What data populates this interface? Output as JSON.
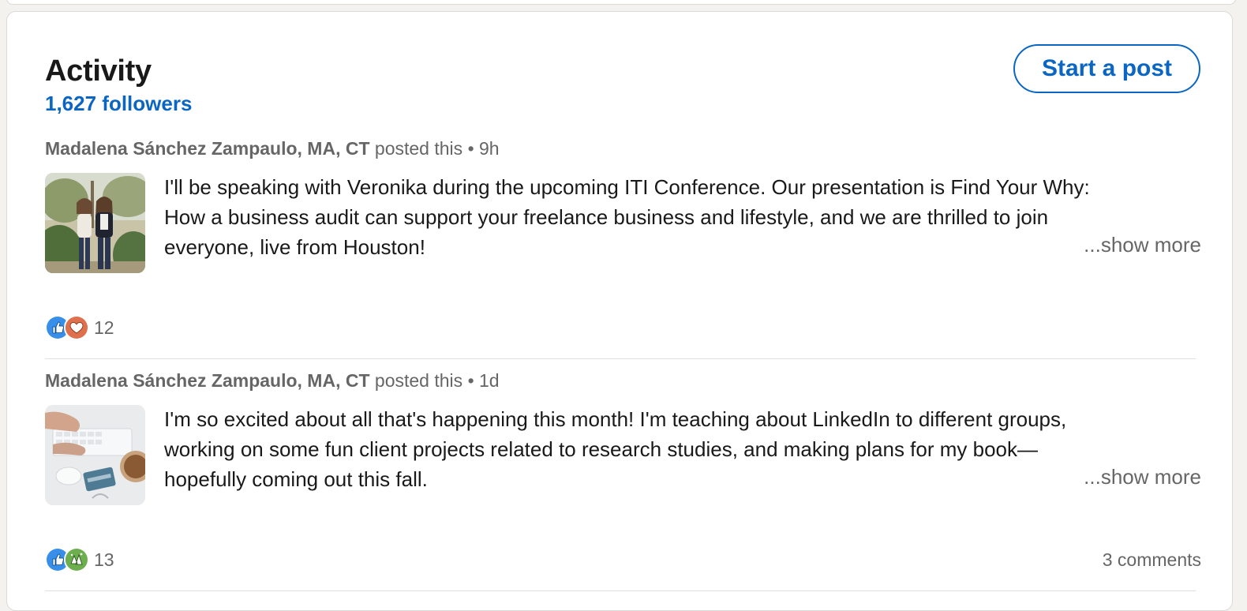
{
  "activity": {
    "title": "Activity",
    "followers": "1,627 followers",
    "start_post_label": "Start a post"
  },
  "posts": [
    {
      "author": "Madalena Sánchez Zampaulo, MA, CT",
      "action": "posted this",
      "separator": "•",
      "time": "9h",
      "text_lines": [
        "I'll be speaking with Veronika during the upcoming ITI Conference. Our presentation is Find Your Why:",
        "How a business audit can support your freelance business and lifestyle, and we are thrilled to join",
        "everyone, live from Houston!"
      ],
      "show_more": "...show more",
      "reactions": [
        "like-icon",
        "love-icon"
      ],
      "reaction_count": "12",
      "comments": ""
    },
    {
      "author": "Madalena Sánchez Zampaulo, MA, CT",
      "action": "posted this",
      "separator": "•",
      "time": "1d",
      "text_lines": [
        "I'm so excited about all that's happening this month! I'm teaching about LinkedIn to different groups,",
        "working on some fun client projects related to research studies, and making plans for my book—",
        "hopefully coming out this fall."
      ],
      "show_more": "...show more",
      "reactions": [
        "like-icon",
        "celebrate-icon"
      ],
      "reaction_count": "13",
      "comments": "3 comments"
    }
  ],
  "colors": {
    "accent": "#0a66c2",
    "text": "#191919",
    "muted": "#666666",
    "like": "#378fe9",
    "love": "#df704d",
    "celebrate": "#6dae4f"
  }
}
